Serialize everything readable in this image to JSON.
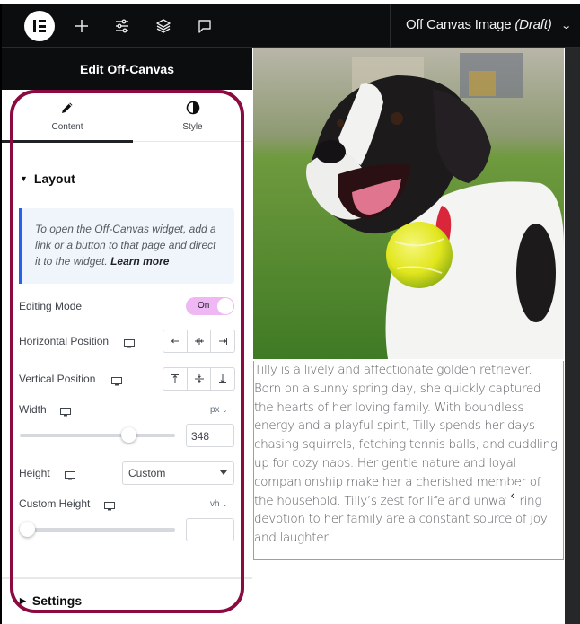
{
  "topbar": {
    "logo": "elementor-logo",
    "icons": [
      "add-icon",
      "site-settings-icon",
      "structure-layers-icon",
      "notes-icon"
    ],
    "page_title": "Off Canvas Image",
    "page_status": "(Draft)"
  },
  "panel": {
    "title": "Edit Off-Canvas",
    "tabs": [
      {
        "label": "Content",
        "icon": "pencil-icon",
        "active": true
      },
      {
        "label": "Style",
        "icon": "contrast-icon",
        "active": false
      }
    ],
    "layout_section": {
      "title": "Layout",
      "notice_text": "To open the Off-Canvas widget, add a link or a button to that page and direct it to the widget.",
      "notice_link": "Learn more",
      "editing_mode": {
        "label": "Editing Mode",
        "value": "On"
      },
      "horizontal_position": {
        "label": "Horizontal Position",
        "options": [
          "start",
          "center",
          "end"
        ]
      },
      "vertical_position": {
        "label": "Vertical Position",
        "options": [
          "top",
          "middle",
          "bottom"
        ]
      },
      "width": {
        "label": "Width",
        "unit": "px",
        "value": "348",
        "slider_fraction": 0.7
      },
      "height": {
        "label": "Height",
        "selected": "Custom"
      },
      "custom_height": {
        "label": "Custom Height",
        "unit": "vh",
        "value": "",
        "slider_fraction": 0.0
      }
    },
    "settings_section": {
      "title": "Settings"
    }
  },
  "canvas": {
    "image_alt": "Black and white puppy with a yellow tennis ball on grass",
    "text": "Tilly is a lively and affectionate golden retriever. Born on a sunny spring day, she quickly captured the hearts of her loving family. With boundless energy and a playful spirit, Tilly spends her days chasing squirrels, fetching tennis balls, and cuddling up for cozy naps. Her gentle nature and loyal companionship make her a cherished member of the household. Tilly’s zest for life and unwavering devotion to her family are a constant source of joy and laughter.",
    "close_glyph": "‹"
  },
  "colors": {
    "highlight": "#8b0a3f",
    "toggle_on": "#f0b7f5",
    "notice_accent": "#2563eb",
    "topbar_bg": "#0c0d0e"
  }
}
